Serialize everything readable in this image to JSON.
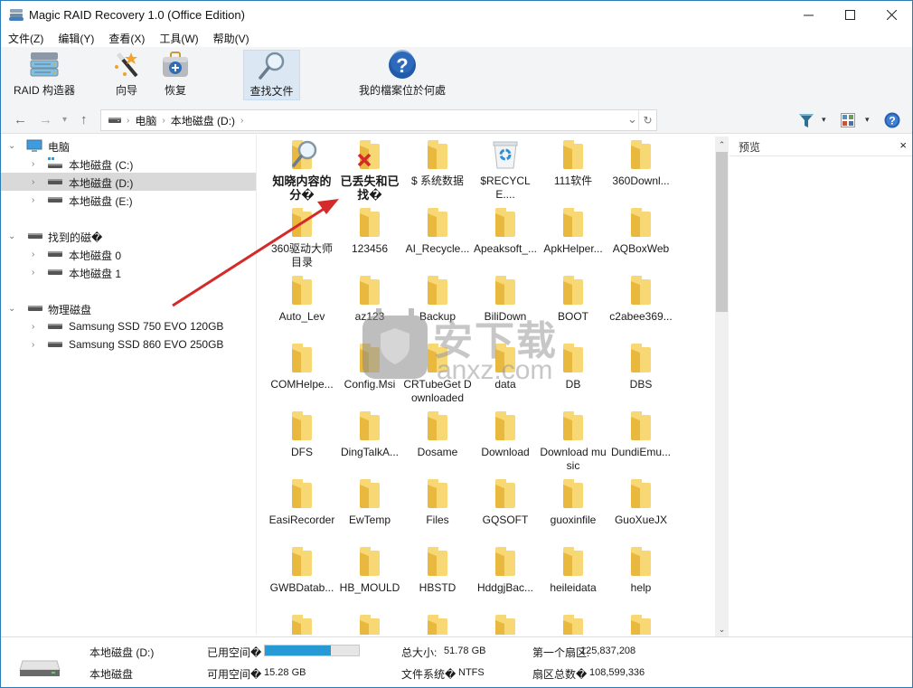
{
  "window": {
    "title": "Magic RAID Recovery 1.0 (Office Edition)",
    "controls": {
      "minimize": "—",
      "maximize": "☐",
      "close": "✕"
    }
  },
  "menu": [
    {
      "label": "文件(Z)"
    },
    {
      "label": "编辑(Y)"
    },
    {
      "label": "查看(X)"
    },
    {
      "label": "工具(W)"
    },
    {
      "label": "帮助(V)"
    }
  ],
  "toolbar": {
    "raid_builder": "RAID 构造器",
    "wizard": "向导",
    "recover": "恢复",
    "find_files": "查找文件",
    "where_files": "我的檔案位於何處"
  },
  "nav": {
    "back": "←",
    "forward": "→",
    "history": "▾",
    "up": "↑",
    "breadcrumb": [
      "电脑",
      "本地磁盘 (D:)"
    ],
    "dropdown": "⌄",
    "refresh": "↻",
    "filter_dd": "▾",
    "view_dd": "▾"
  },
  "tree": {
    "computer": "电脑",
    "computer_items": [
      "本地磁盘 (C:)",
      "本地磁盘 (D:)",
      "本地磁盘 (E:)"
    ],
    "selected": "本地磁盘 (D:)",
    "found": "找到的磁�",
    "found_items": [
      "本地磁盘 0",
      "本地磁盘 1"
    ],
    "physical": "物理磁盘",
    "physical_items": [
      "Samsung SSD 750 EVO 120GB",
      "Samsung SSD 860 EVO 250GB"
    ]
  },
  "files": [
    {
      "name": "知晓内容的分�",
      "type": "search",
      "bold": true
    },
    {
      "name": "已丢失和已找�",
      "type": "lost",
      "bold": true
    },
    {
      "name": "$ 系统数据",
      "type": "folder"
    },
    {
      "name": "$RECYCLE....",
      "type": "recycle"
    },
    {
      "name": "111软件",
      "type": "folder"
    },
    {
      "name": "360Downl...",
      "type": "folder"
    },
    {
      "name": "360驱动大师目录",
      "type": "folder"
    },
    {
      "name": "123456",
      "type": "folder"
    },
    {
      "name": "AI_Recycle...",
      "type": "folder"
    },
    {
      "name": "Apeaksoft_...",
      "type": "folder"
    },
    {
      "name": "ApkHelper...",
      "type": "folder"
    },
    {
      "name": "AQBoxWeb",
      "type": "folder"
    },
    {
      "name": "Auto_Lev",
      "type": "folder"
    },
    {
      "name": "az123",
      "type": "folder"
    },
    {
      "name": "Backup",
      "type": "folder"
    },
    {
      "name": "BiliDown",
      "type": "folder"
    },
    {
      "name": "BOOT",
      "type": "folder"
    },
    {
      "name": "c2abee369...",
      "type": "folder"
    },
    {
      "name": "COMHelpe...",
      "type": "folder"
    },
    {
      "name": "Config.Msi",
      "type": "folder"
    },
    {
      "name": "CRTubeGet Downloaded",
      "type": "folder"
    },
    {
      "name": "data",
      "type": "folder"
    },
    {
      "name": "DB",
      "type": "folder"
    },
    {
      "name": "DBS",
      "type": "folder"
    },
    {
      "name": "DFS",
      "type": "folder"
    },
    {
      "name": "DingTalkA...",
      "type": "folder"
    },
    {
      "name": "Dosame",
      "type": "folder"
    },
    {
      "name": "Download",
      "type": "folder"
    },
    {
      "name": "Download music",
      "type": "folder"
    },
    {
      "name": "DundiEmu...",
      "type": "folder"
    },
    {
      "name": "EasiRecorder",
      "type": "folder"
    },
    {
      "name": "EwTemp",
      "type": "folder"
    },
    {
      "name": "Files",
      "type": "folder"
    },
    {
      "name": "GQSOFT",
      "type": "folder"
    },
    {
      "name": "guoxinfile",
      "type": "folder"
    },
    {
      "name": "GuoXueJX",
      "type": "folder"
    },
    {
      "name": "GWBDatab...",
      "type": "folder"
    },
    {
      "name": "HB_MOULD",
      "type": "folder"
    },
    {
      "name": "HBSTD",
      "type": "folder"
    },
    {
      "name": "HddgjBac...",
      "type": "folder"
    },
    {
      "name": "heileidata",
      "type": "folder"
    },
    {
      "name": "help",
      "type": "folder"
    },
    {
      "name": "",
      "type": "folder"
    },
    {
      "name": "",
      "type": "folder"
    },
    {
      "name": "",
      "type": "folder"
    },
    {
      "name": "",
      "type": "folder"
    },
    {
      "name": "",
      "type": "folder"
    },
    {
      "name": "",
      "type": "folder"
    }
  ],
  "scrollbar": {
    "position_fraction": 0.0,
    "visible_fraction": 0.34
  },
  "preview": {
    "title": "预览",
    "close": "×"
  },
  "status": {
    "drive_name": "本地磁盘 (D:)",
    "drive_type": "本地磁盘",
    "used_label": "已用空间�",
    "used_percent": 70.5,
    "free_label": "可用空间�",
    "free_value": "15.28 GB",
    "total_label": "总大小:",
    "total_value": "51.78 GB",
    "fs_label": "文件系统�",
    "fs_value": "NTFS",
    "first_sector_label": "第一个扇区:",
    "first_sector_value": "125,837,208",
    "sector_count_label": "扇区总数�",
    "sector_count_value": "108,599,336"
  },
  "watermark": {
    "text": "安下载",
    "sub": "anxz.com",
    "badge": "安"
  },
  "colors": {
    "accent": "#279ad6",
    "folder": "#f6d36b",
    "selected": "#d9d9d9",
    "active_tool": "#dbe8f4",
    "annotation": "#d42a2a"
  }
}
